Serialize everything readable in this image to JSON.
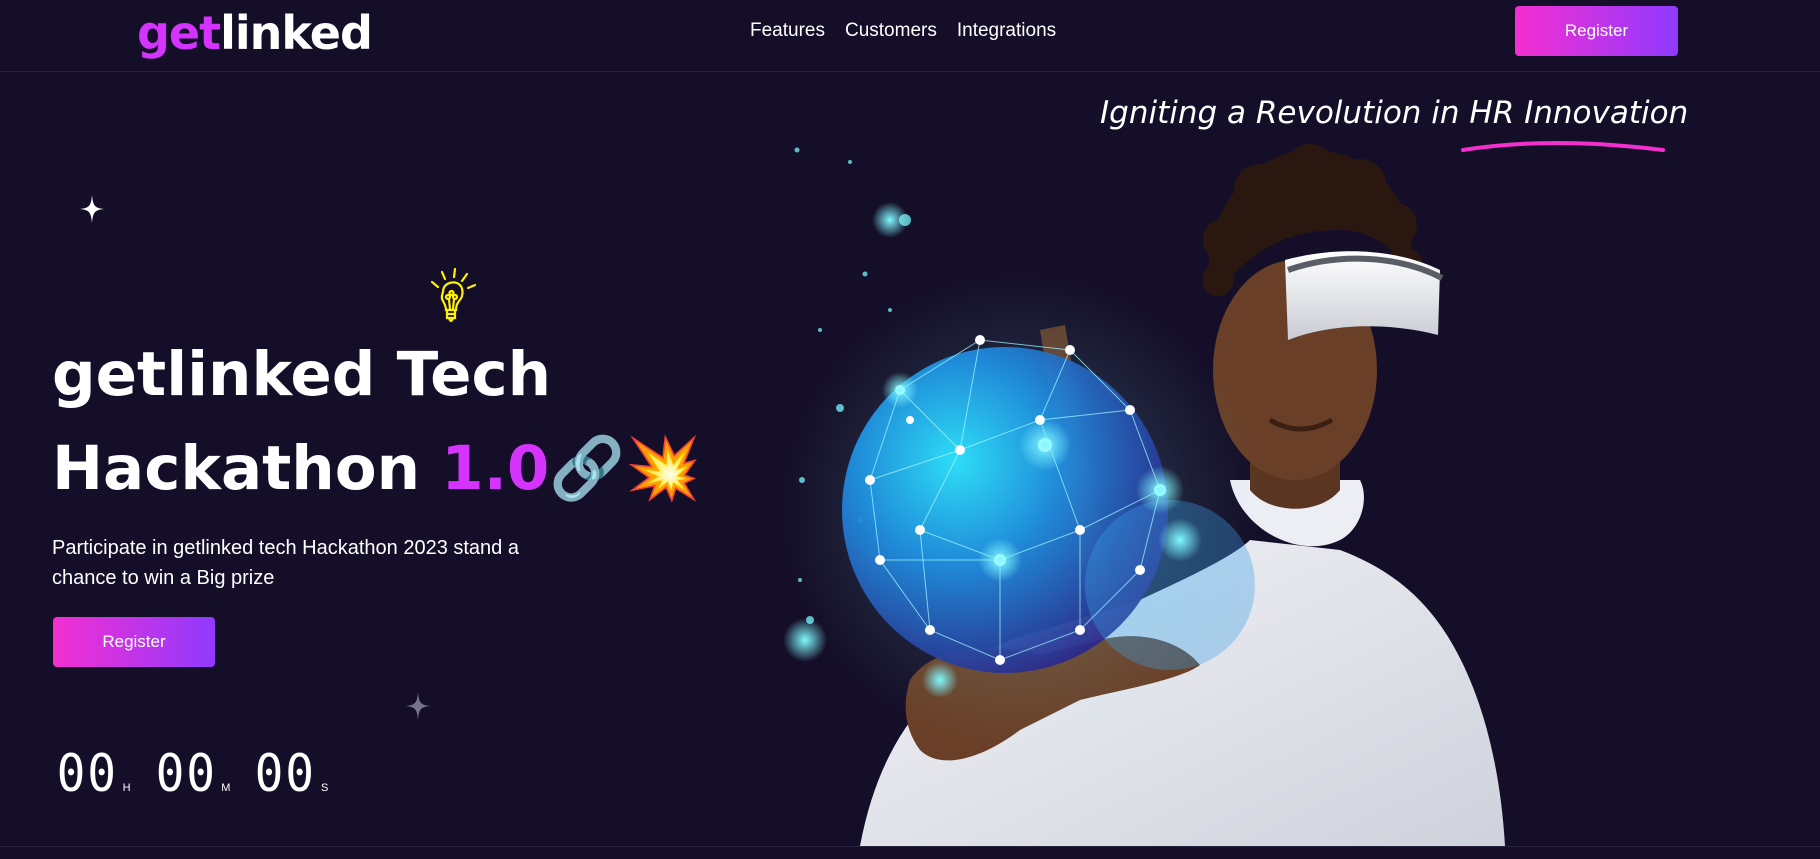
{
  "header": {
    "logo_accent": "get",
    "logo_rest": "linked",
    "nav": [
      "Features",
      "Customers",
      "Integrations"
    ],
    "register_label": "Register"
  },
  "tagline": "Igniting a Revolution in HR Innovation",
  "hero": {
    "title_line1": "getlinked Tech",
    "title_line2": "Hackathon",
    "title_version": "1.0",
    "title_emoji": "🔗💥",
    "description": "Participate in getlinked tech Hackathon 2023 stand a chance to win a Big prize",
    "register_label": "Register"
  },
  "countdown": [
    {
      "value": "00",
      "unit": "H"
    },
    {
      "value": "00",
      "unit": "M"
    },
    {
      "value": "00",
      "unit": "S"
    }
  ],
  "icons": {
    "bulb": "lightbulb-icon",
    "star": "sparkle-star-icon"
  },
  "colors": {
    "background": "#150e28",
    "accent": "#d434fe",
    "gradient_start": "#f42fd0",
    "gradient_end": "#903aff",
    "underline": "#f42fd0"
  }
}
